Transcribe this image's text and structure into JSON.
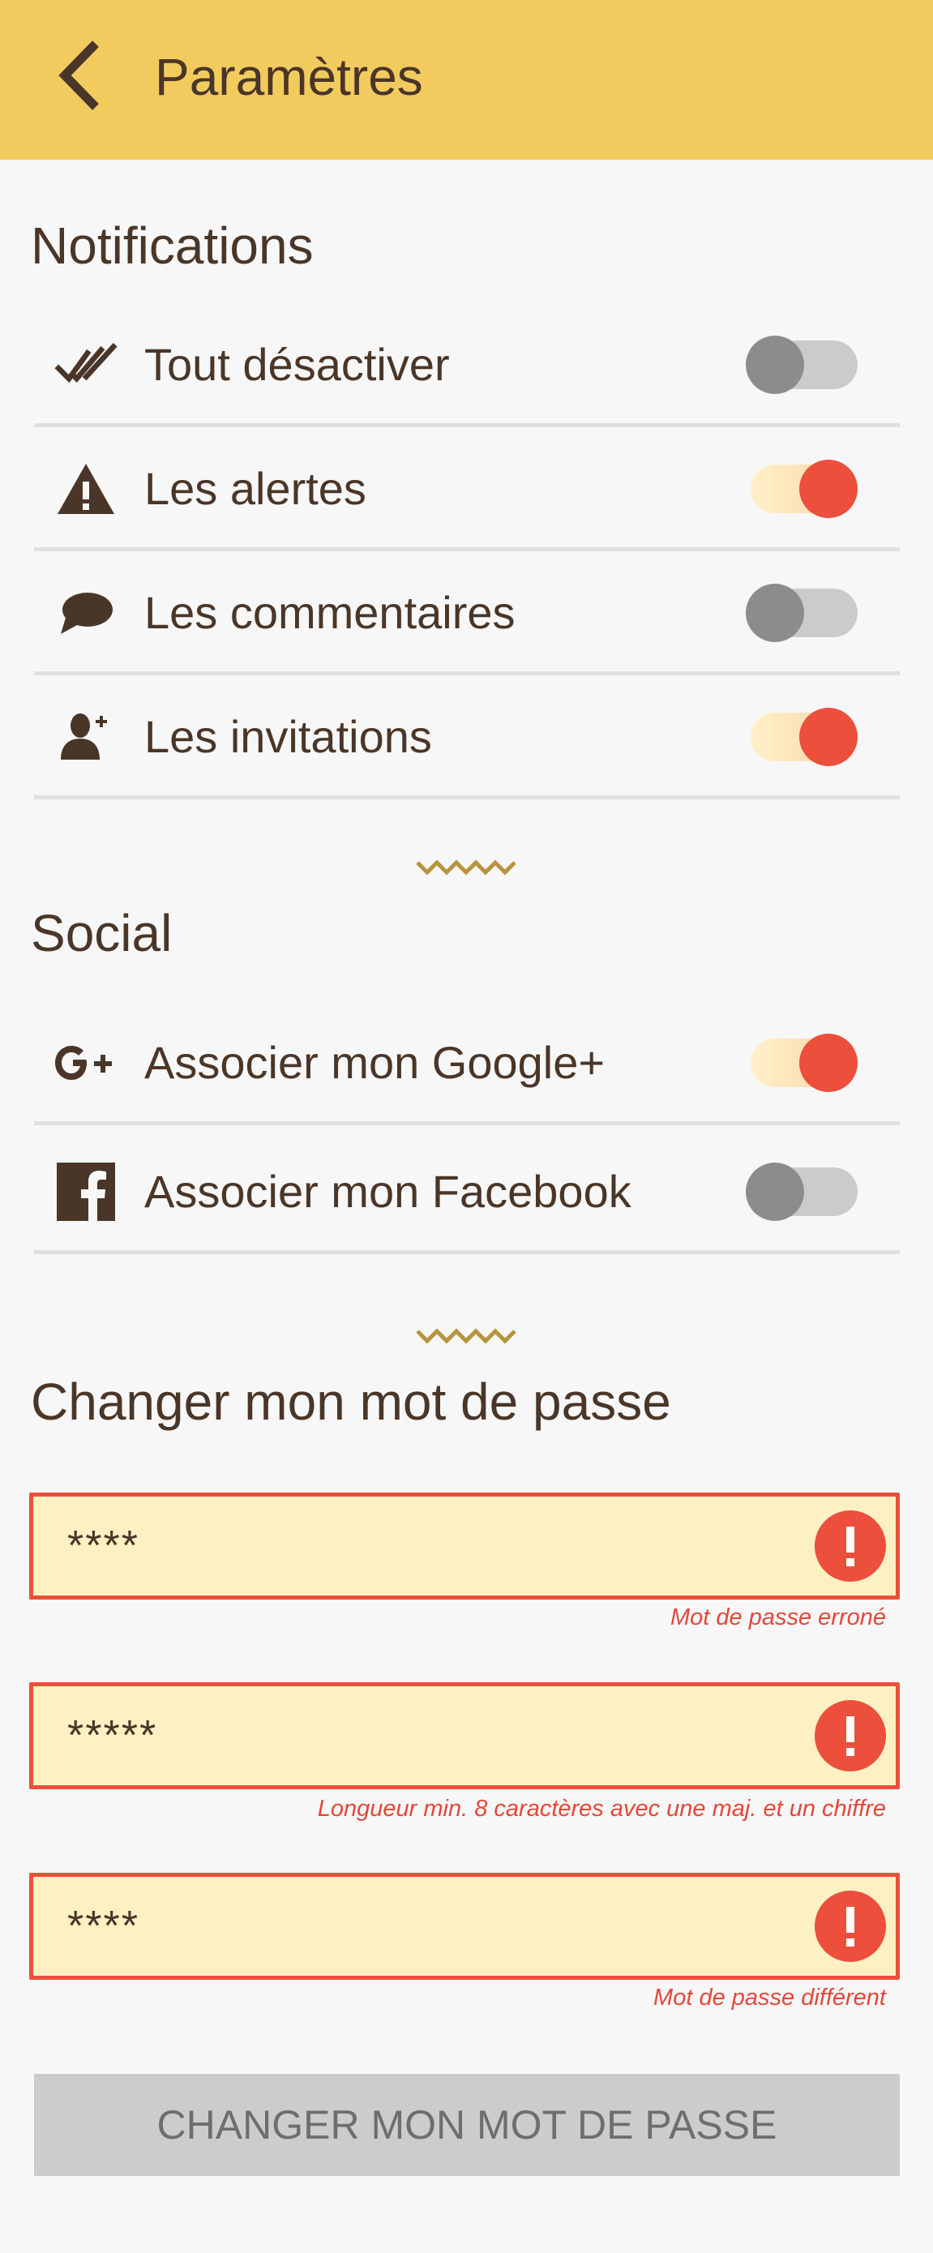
{
  "header": {
    "title": "Paramètres",
    "back_icon": "chevron-left-icon",
    "background": "#f2cb5f"
  },
  "notifications": {
    "title": "Notifications",
    "items": [
      {
        "label": "Tout désactiver",
        "icon": "double-check-icon",
        "enabled": false
      },
      {
        "label": "Les alertes",
        "icon": "warning-icon",
        "enabled": true
      },
      {
        "label": "Les commentaires",
        "icon": "comment-icon",
        "enabled": false
      },
      {
        "label": "Les invitations",
        "icon": "add-user-icon",
        "enabled": true
      }
    ]
  },
  "social": {
    "title": "Social",
    "items": [
      {
        "label": "Associer mon Google+",
        "icon": "google-plus-icon",
        "enabled": true
      },
      {
        "label": "Associer mon Facebook",
        "icon": "facebook-icon",
        "enabled": false
      }
    ]
  },
  "password": {
    "title": "Changer mon mot de passe",
    "fields": [
      {
        "value": "****",
        "error": "Mot de passe erroné"
      },
      {
        "value": "*****",
        "error": "Longueur min. 8 caractères avec une maj. et un chiffre"
      },
      {
        "value": "****",
        "error": "Mot de passe différent"
      }
    ],
    "submit_label": "CHANGER MON MOT DE PASSE"
  },
  "colors": {
    "accent": "#ec4f3c",
    "text": "#4a3628",
    "divider_ornament": "#b8943f",
    "field_background": "#fdf1c4"
  }
}
